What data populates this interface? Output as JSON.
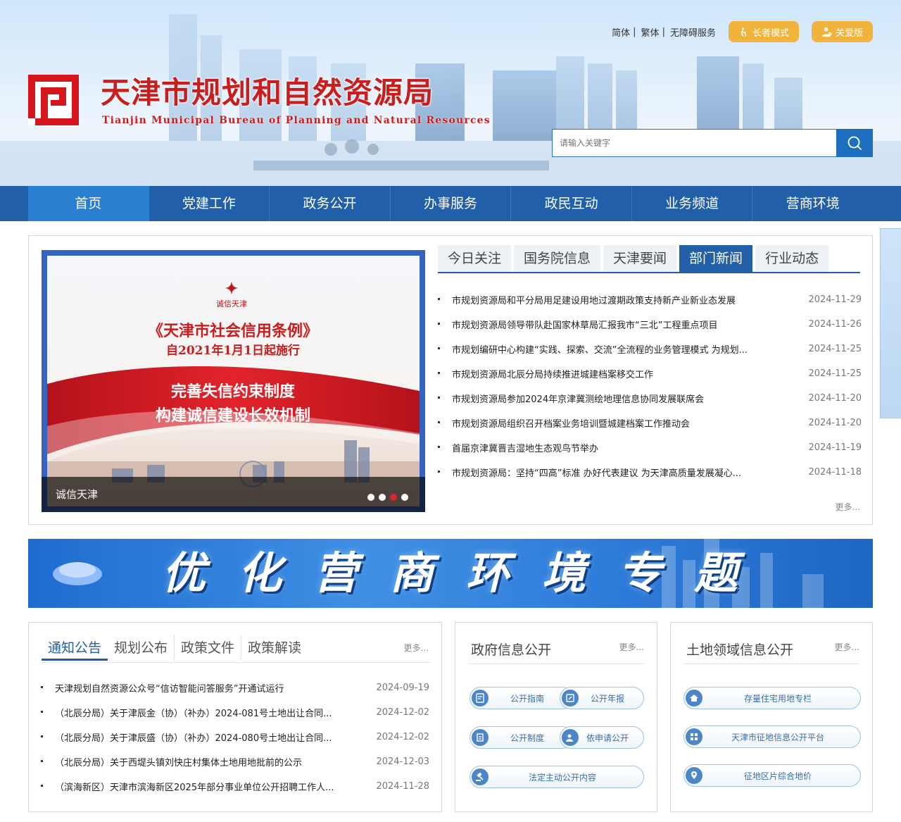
{
  "header": {
    "links": [
      "简体",
      "繁体",
      "无障碍服务"
    ],
    "elder_mode": "长者模式",
    "care_mode": "关爱版",
    "title": "天津市规划和自然资源局",
    "subtitle": "Tianjin Municipal Bureau of Planning and Natural Resources",
    "search_placeholder": "请输入关键字"
  },
  "nav": [
    "首页",
    "党建工作",
    "政务公开",
    "办事服务",
    "政民互动",
    "业务频道",
    "营商环境"
  ],
  "slider": {
    "caption": "诚信天津",
    "poster_logo": "诚信天津",
    "poster_line1": "《天津市社会信用条例》",
    "poster_line2": "自2021年1月1日起施行",
    "poster_line3": "完善失信约束制度",
    "poster_line4": "构建诚信建设长效机制"
  },
  "news": {
    "tabs": [
      "今日关注",
      "国务院信息",
      "天津要闻",
      "部门新闻",
      "行业动态"
    ],
    "items": [
      {
        "title": "市规划资源局和平分局用足建设用地过渡期政策支持新产业新业态发展",
        "date": "2024-11-29"
      },
      {
        "title": "市规划资源局领导带队赴国家林草局汇报我市“三北”工程重点项目",
        "date": "2024-11-26"
      },
      {
        "title": "市规划编研中心构建“实践、探索、交流”全流程的业务管理模式 为规划...",
        "date": "2024-11-25"
      },
      {
        "title": "市规划资源局北辰分局持续推进城建档案移交工作",
        "date": "2024-11-25"
      },
      {
        "title": "市规划资源局参加2024年京津冀测绘地理信息协同发展联席会",
        "date": "2024-11-20"
      },
      {
        "title": "市规划资源局组织召开档案业务培训暨城建档案工作推动会",
        "date": "2024-11-20"
      },
      {
        "title": "首届京津冀晋吉湿地生态观鸟节举办",
        "date": "2024-11-19"
      },
      {
        "title": "市规划资源局：坚持“四高”标准 办好代表建议 为天津高质量发展凝心...",
        "date": "2024-11-18"
      }
    ],
    "more": "更多..."
  },
  "banner": {
    "title": "优化营商环境专题"
  },
  "notice": {
    "tabs": [
      "通知公告",
      "规划公布",
      "政策文件",
      "政策解读"
    ],
    "more": "更多...",
    "items": [
      {
        "title": "天津规划自然资源公众号“信访智能问答服务”开通试运行",
        "date": "2024-09-19"
      },
      {
        "title": "（北辰分局）关于津辰金（协）（补办）2024-081号土地出让合同...",
        "date": "2024-12-02"
      },
      {
        "title": "（北辰分局）关于津辰盛（协）（补办）2024-080号土地出让合同...",
        "date": "2024-12-02"
      },
      {
        "title": "（北辰分局）关于西堤头镇刘快庄村集体土地用地批前的公示",
        "date": "2024-12-03"
      },
      {
        "title": "（滨海新区）天津市滨海新区2025年部分事业单位公开招聘工作人...",
        "date": "2024-11-28"
      }
    ]
  },
  "gov_info": {
    "title": "政府信息公开",
    "more": "更多...",
    "buttons": [
      "公开指南",
      "公开年报",
      "公开制度",
      "依申请公开",
      "法定主动公开内容"
    ]
  },
  "land_info": {
    "title": "土地领域信息公开",
    "more": "更多...",
    "buttons": [
      "存量住宅用地专栏",
      "天津市征地信息公开平台",
      "征地区片综合地价"
    ]
  },
  "colors": {
    "brand_blue": "#2160a8",
    "accent_red": "#c81e1e",
    "gold": "#f2b33d"
  }
}
